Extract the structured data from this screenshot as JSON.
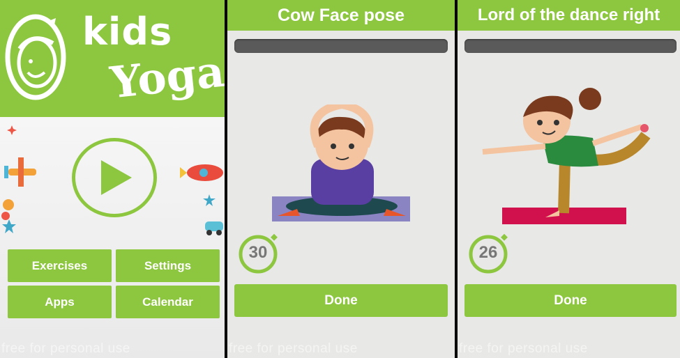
{
  "home": {
    "logo": {
      "word1": "kids",
      "word2": "Yoga"
    },
    "buttons": {
      "exercises": "Exercises",
      "settings": "Settings",
      "apps": "Apps",
      "calendar": "Calendar"
    },
    "watermark": "free for personal use"
  },
  "exercise1": {
    "title": "Cow Face pose",
    "timer": "30",
    "done": "Done",
    "watermark": "free for personal use"
  },
  "exercise2": {
    "title": "Lord of the dance right",
    "timer": "26",
    "done": "Done",
    "watermark": "free for personal use"
  },
  "colors": {
    "accent": "#8dc63f",
    "progress_track": "#5a5a5a"
  }
}
